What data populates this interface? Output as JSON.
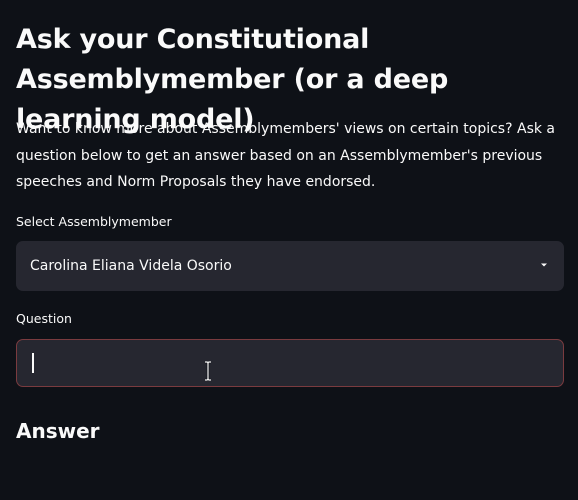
{
  "page": {
    "title": "Ask your Constitutional Assemblymember (or a deep learning model)",
    "intro": "Want to know more about Assemblymembers' views on certain topics? Ask a question below to get an answer based on an Assemblymember's previous speeches and Norm Proposals they have endorsed."
  },
  "select_member": {
    "label": "Select Assemblymember",
    "value": "Carolina Eliana Videla Osorio",
    "icon": "chevron-down-icon"
  },
  "question": {
    "label": "Question",
    "value": "",
    "placeholder": ""
  },
  "answer": {
    "heading": "Answer"
  },
  "colors": {
    "background": "#0e1117",
    "widget_background": "#262730",
    "text": "#fafafa",
    "focus_border": "#7a3b3f"
  }
}
